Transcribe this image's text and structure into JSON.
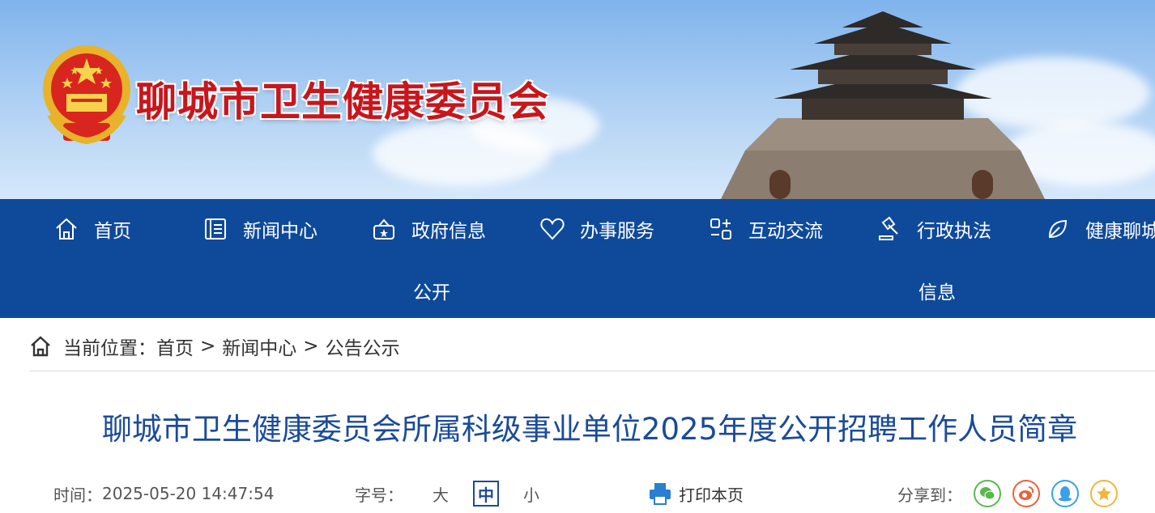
{
  "header": {
    "site_title": "聊城市卫生健康委员会"
  },
  "nav": {
    "items": [
      {
        "label": "首页",
        "icon": "home-icon"
      },
      {
        "label": "新闻中心",
        "icon": "newspaper-icon"
      },
      {
        "label": "政府信息",
        "label_line2": "公开",
        "icon": "government-icon"
      },
      {
        "label": "办事服务",
        "icon": "heart-icon"
      },
      {
        "label": "互动交流",
        "icon": "interaction-icon"
      },
      {
        "label": "行政执法",
        "label_line2": "信息",
        "icon": "gavel-icon"
      },
      {
        "label": "健康聊城",
        "icon": "leaf-icon"
      }
    ]
  },
  "breadcrumb": {
    "prefix": "当前位置：",
    "items": [
      "首页",
      "新闻中心",
      "公告公示"
    ],
    "separator": ">"
  },
  "article": {
    "title": "聊城市卫生健康委员会所属科级事业单位2025年度公开招聘工作人员简章",
    "time_label": "时间：",
    "time_value": "2025-05-20 14:47:54",
    "fontsize_label": "字号：",
    "fontsize_options": [
      "大",
      "中",
      "小"
    ],
    "fontsize_selected": "中",
    "print_label": "打印本页",
    "share_label": "分享到："
  },
  "colors": {
    "nav_bg": "#0f4a9a",
    "title_red": "#c8161d",
    "title_blue": "#1b4b99"
  }
}
